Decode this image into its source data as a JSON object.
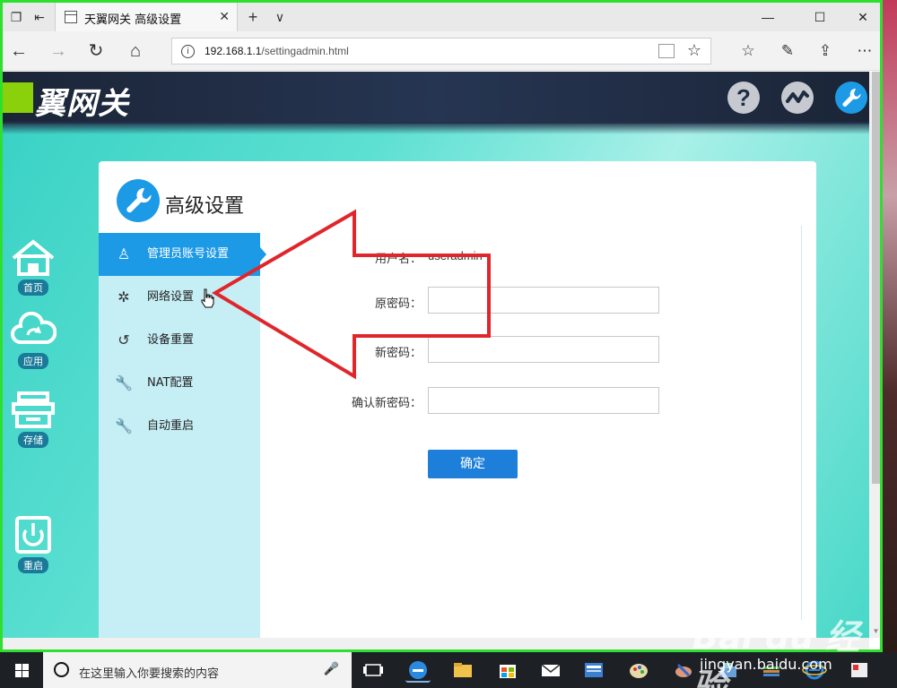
{
  "browser": {
    "tab_title": "天翼网关 高级设置",
    "url_host": "192.168.1.1",
    "url_path": "/settingadmin.html",
    "new_tab_symbol": "+",
    "tab_list_symbol": "∨",
    "tab_close_symbol": "✕",
    "minimize_symbol": "—",
    "maximize_symbol": "☐",
    "close_symbol": "✕",
    "back_symbol": "←",
    "forward_symbol": "→",
    "refresh_symbol": "↻",
    "home_symbol": "⌂",
    "info_symbol": "i",
    "favorite_symbol": "☆",
    "favorites_hub_symbol": "☆",
    "pen_symbol": "✎",
    "share_symbol": "⇪",
    "more_symbol": "⋯"
  },
  "router": {
    "logo_text": "翼网关",
    "header_icons": [
      "help-icon",
      "network-status-icon",
      "advanced-settings-icon"
    ],
    "help_symbol": "?",
    "status_symbol": "〜",
    "settings_symbol": "🔧",
    "side_nav": [
      {
        "label": "首页",
        "icon": "home-icon"
      },
      {
        "label": "应用",
        "icon": "cloud-sync-icon"
      },
      {
        "label": "存储",
        "icon": "storage-icon"
      },
      {
        "label": "重启",
        "icon": "power-icon"
      }
    ],
    "panel_title": "高级设置",
    "menu": [
      {
        "label": "管理员账号设置",
        "icon": "user-icon",
        "symbol": "♙",
        "active": true
      },
      {
        "label": "网络设置",
        "icon": "gear-icon",
        "symbol": "✲",
        "active": false
      },
      {
        "label": "设备重置",
        "icon": "reset-icon",
        "symbol": "↺",
        "active": false
      },
      {
        "label": "NAT配置",
        "icon": "wrench-icon",
        "symbol": "🔧",
        "active": false
      },
      {
        "label": "自动重启",
        "icon": "wrench-icon",
        "symbol": "🔧",
        "active": false
      }
    ],
    "form": {
      "username_label": "用户名：",
      "username_value": "useradmin",
      "old_password_label": "原密码：",
      "old_password_value": "",
      "new_password_label": "新密码：",
      "new_password_value": "",
      "confirm_password_label": "确认新密码：",
      "confirm_password_value": "",
      "submit_label": "确定"
    },
    "colors": {
      "accent": "#1d9ae6",
      "menu_bg": "#c6eef5",
      "header_bg": "#1f2b40",
      "logo_green": "#8bd10b",
      "arrow_red": "#e0262b"
    }
  },
  "taskbar": {
    "search_placeholder": "在这里输入你要搜索的内容",
    "apps": [
      "task-view-icon",
      "edge-icon",
      "file-explorer-icon",
      "store-icon",
      "mail-icon",
      "app-icon",
      "paint-icon",
      "app-icon",
      "app-icon",
      "app-icon",
      "ie-icon",
      "app-icon"
    ]
  },
  "watermark": {
    "brand": "Bai du 经验",
    "url": "jingyan.baidu.com"
  }
}
